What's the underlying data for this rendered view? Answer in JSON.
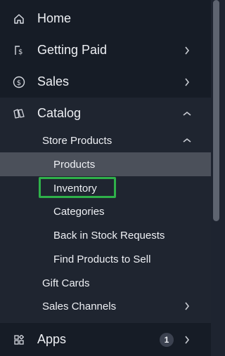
{
  "nav": {
    "home": {
      "label": "Home",
      "icon": "home-icon"
    },
    "getting_paid": {
      "label": "Getting Paid",
      "icon": "invoice-dollar-icon"
    },
    "sales": {
      "label": "Sales",
      "icon": "dollar-circle-icon"
    },
    "catalog": {
      "label": "Catalog",
      "icon": "catalog-icon",
      "store_products": {
        "label": "Store Products",
        "items": [
          "Products",
          "Inventory",
          "Categories",
          "Back in Stock Requests",
          "Find Products to Sell"
        ]
      },
      "gift_cards": "Gift Cards",
      "sales_channels": "Sales Channels"
    },
    "apps": {
      "label": "Apps",
      "icon": "apps-grid-icon",
      "badge": "1"
    }
  },
  "selected_item": "Products",
  "highlighted_item": "Inventory",
  "colors": {
    "background": "#161c26",
    "catalog_section_bg": "#1f2530",
    "active_item_bg": "#4b505a",
    "highlight_border": "#2fb14a"
  }
}
